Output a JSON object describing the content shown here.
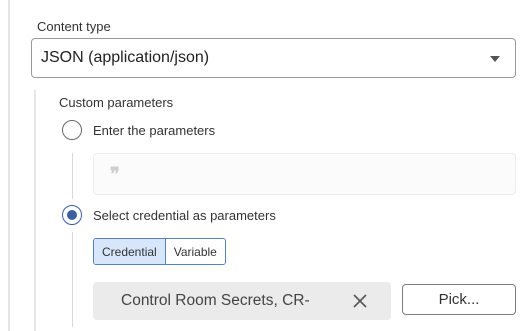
{
  "content_type": {
    "label": "Content type",
    "selected": "JSON (application/json)",
    "caret_icon": "chevron-down-icon"
  },
  "custom_parameters": {
    "label": "Custom parameters",
    "options": [
      {
        "label": "Enter the parameters",
        "selected": false
      },
      {
        "label": "Select credential as parameters",
        "selected": true
      }
    ],
    "param_input": {
      "icon": "quote-icon",
      "glyph": "❞"
    }
  },
  "credential_picker": {
    "tabs": [
      {
        "label": "Credential",
        "active": true
      },
      {
        "label": "Variable",
        "active": false
      }
    ],
    "value": "Control Room Secrets, CR-",
    "clear_icon": "close-icon",
    "pick_label": "Pick..."
  },
  "colors": {
    "accent": "#3c5fa0",
    "active_tab_bg": "#d7e6fb",
    "field_bg": "#ebebeb"
  }
}
